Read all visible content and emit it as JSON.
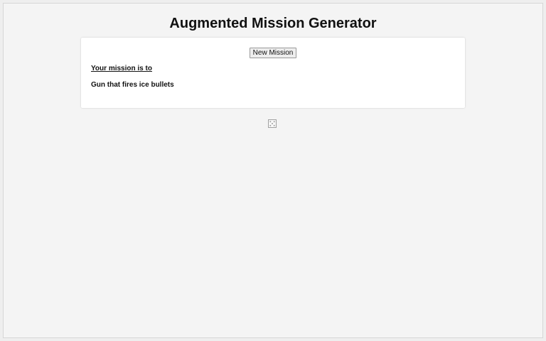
{
  "page": {
    "title": "Augmented Mission Generator"
  },
  "generator": {
    "button_label": "New Mission",
    "intro_text": "Your mission is to",
    "mission_text": "Gun that fires ice bullets"
  },
  "icons": {
    "dice": "dice-icon"
  },
  "colors": {
    "background": "#f4f4f4",
    "card": "#ffffff",
    "text": "#111111",
    "button": "#eeeeee"
  }
}
